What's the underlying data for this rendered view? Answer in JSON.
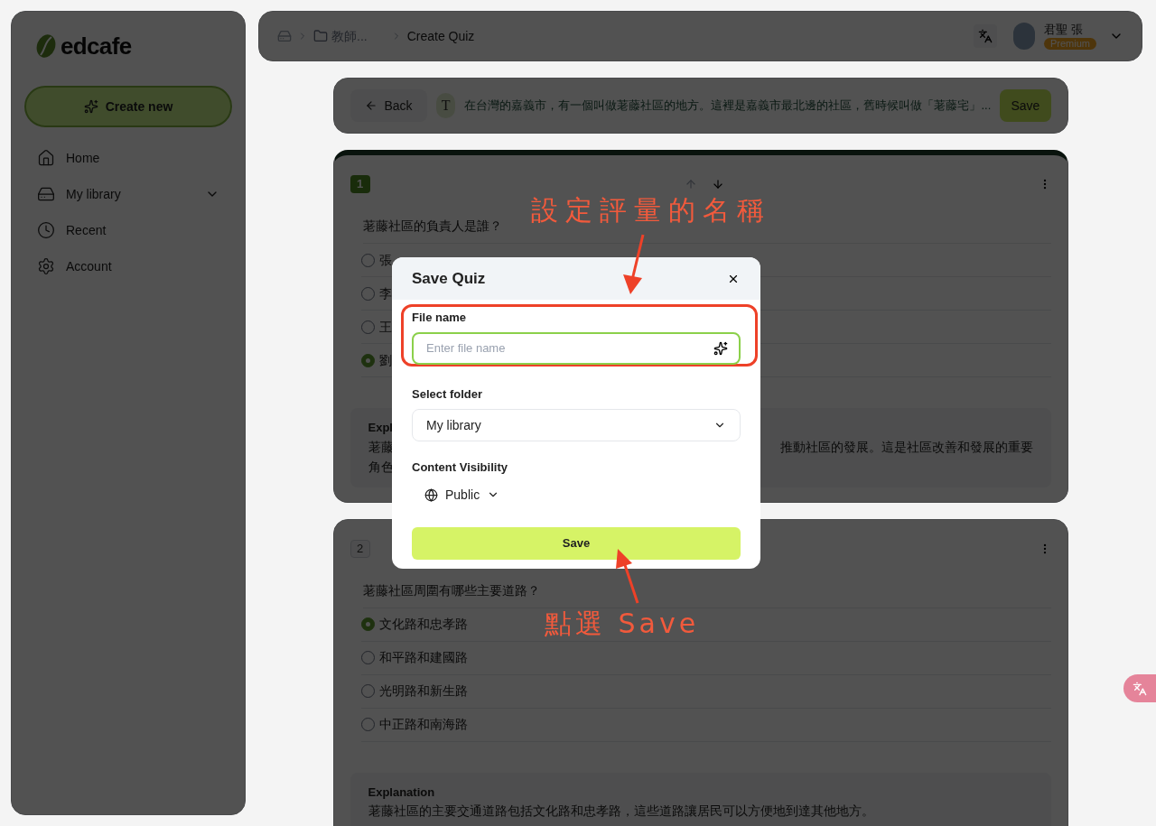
{
  "sidebar": {
    "logo": "edcafe",
    "create_button": "Create new",
    "items": [
      {
        "label": "Home",
        "expandable": false
      },
      {
        "label": "My library",
        "expandable": true
      },
      {
        "label": "Recent",
        "expandable": false
      },
      {
        "label": "Account",
        "expandable": false
      }
    ]
  },
  "breadcrumb": [
    {
      "kind": "home"
    },
    {
      "kind": "folder",
      "label": "教師..."
    },
    {
      "kind": "page",
      "label": "Create Quiz"
    }
  ],
  "user": {
    "name": "君聖 張",
    "badge": "Premium"
  },
  "quiz_bar": {
    "back": "Back",
    "source_badge": "T",
    "source_text": "在台灣的嘉義市，有一個叫做荖藤社區的地方。這裡是嘉義市最北邊的社區，舊時候叫做「荖藤宅」...",
    "save": "Save"
  },
  "questions": [
    {
      "number": "1",
      "active": true,
      "question": "荖藤社區的負責人是誰？",
      "options": [
        {
          "label": "張",
          "selected": false
        },
        {
          "label": "李",
          "selected": false
        },
        {
          "label": "王",
          "selected": false
        },
        {
          "label": "劉",
          "selected": true
        }
      ],
      "explanation_title": "Expl",
      "explanation_lines": [
        {
          "left": "荖藤",
          "right": "推動社區的發展。這是社區改善和發展的重要"
        },
        {
          "left": "角色"
        }
      ]
    },
    {
      "number": "2",
      "active": false,
      "question": "荖藤社區周圍有哪些主要道路？",
      "options": [
        {
          "label": "文化路和忠孝路",
          "selected": true
        },
        {
          "label": "和平路和建國路",
          "selected": false
        },
        {
          "label": "光明路和新生路",
          "selected": false
        },
        {
          "label": "中正路和南海路",
          "selected": false
        }
      ],
      "explanation_title": "Explanation",
      "explanation_lines": [
        {
          "left": "荖藤社區的主要交通道路包括文化路和忠孝路，這些道路讓居民可以方便地到達其他地方。"
        }
      ]
    }
  ],
  "modal": {
    "title": "Save Quiz",
    "file_label": "File name",
    "file_placeholder": "Enter file name",
    "folder_label": "Select folder",
    "folder_value": "My library",
    "visibility_label": "Content Visibility",
    "visibility_value": "Public",
    "save": "Save"
  },
  "annotations": [
    {
      "text": "設定評量的名稱"
    },
    {
      "text": "點選 Save"
    }
  ]
}
